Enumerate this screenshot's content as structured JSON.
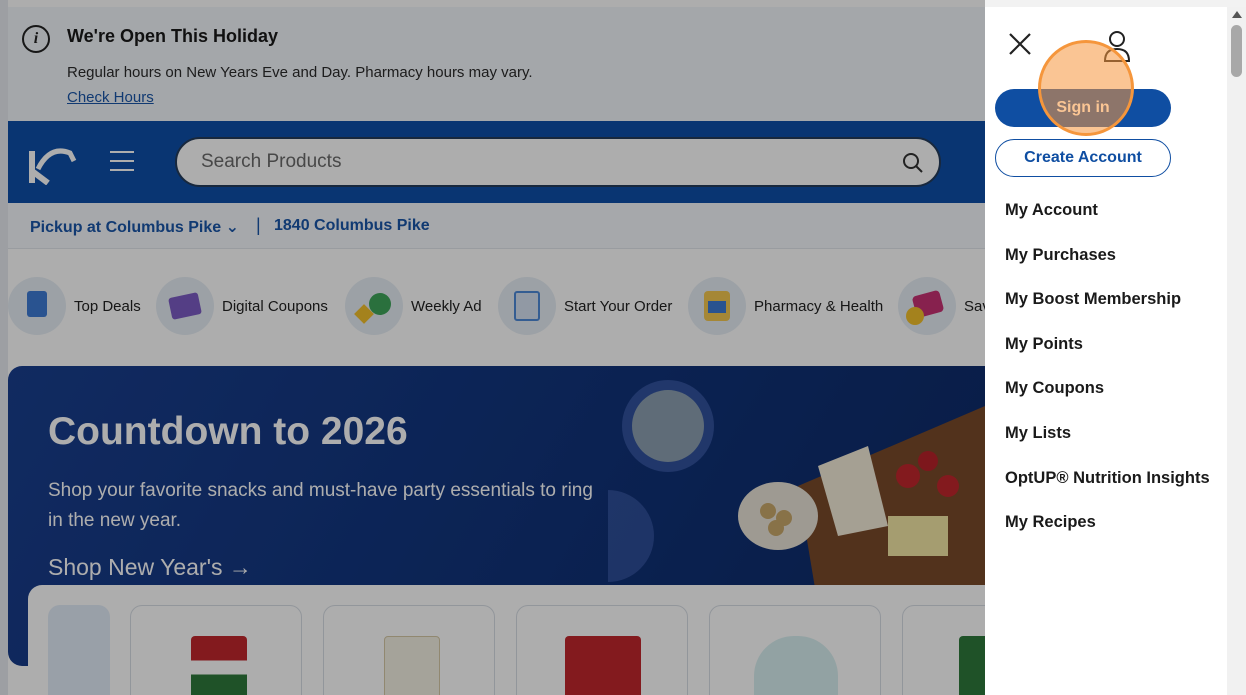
{
  "banner": {
    "title": "We're Open This Holiday",
    "subtitle": "Regular hours on New Years Eve and Day. Pharmacy hours may vary.",
    "link": "Check Hours"
  },
  "header": {
    "search_placeholder": "Search Products"
  },
  "pickup": {
    "store": "Pickup at Columbus Pike ⌄",
    "separator": "|",
    "address": "1840 Columbus Pike"
  },
  "categories": [
    {
      "label": "Top Deals",
      "icon": "tag-icon"
    },
    {
      "label": "Digital Coupons",
      "icon": "coupon-icon"
    },
    {
      "label": "Weekly Ad",
      "icon": "weekly-ad-icon"
    },
    {
      "label": "Start Your Order",
      "icon": "cart-icon"
    },
    {
      "label": "Pharmacy & Health",
      "icon": "pharmacy-icon"
    },
    {
      "label": "Sav",
      "icon": "savings-icon"
    }
  ],
  "hero": {
    "title": "Countdown to 2026",
    "description": "Shop your favorite snacks and must-have party essentials to ring in the new year.",
    "cta": "Shop New Year's →"
  },
  "drawer": {
    "sign_in": "Sign in",
    "create_account": "Create Account",
    "menu": [
      "My Account",
      "My Purchases",
      "My Boost Membership",
      "My Points",
      "My Coupons",
      "My Lists",
      "OptUP® Nutrition Insights",
      "My Recipes"
    ]
  },
  "colors": {
    "brand_blue": "#0f4ea2",
    "highlight": "#f5963c"
  }
}
